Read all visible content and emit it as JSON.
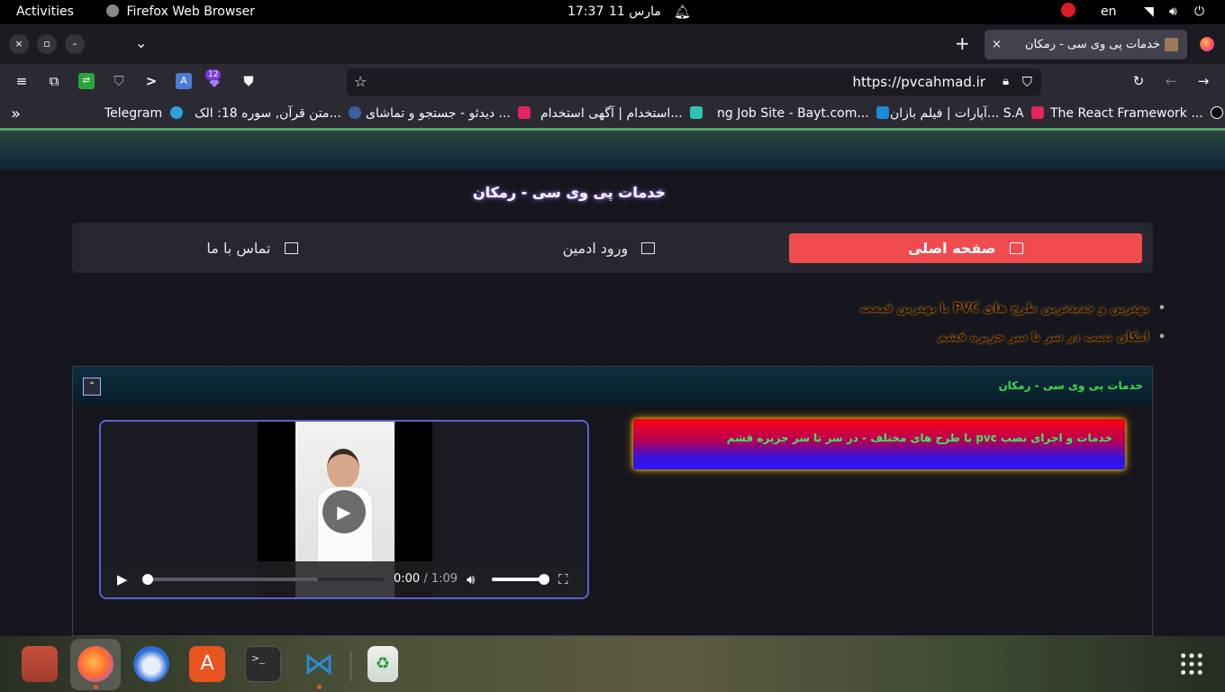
{
  "system_bar": {
    "activities": "Activities",
    "app_name": "Firefox Web Browser",
    "clock": "17:37",
    "date": "مارس 11",
    "language": "en"
  },
  "browser": {
    "tab": {
      "title": "خدمات پی وی سی - رمکان",
      "close": "×"
    },
    "new_tab": "+",
    "window_controls": {
      "close": "×",
      "restore": "▫",
      "minimize": "–"
    },
    "tab_list": "⌄",
    "url": "https://pvcahmad.ir",
    "extension_badge": "12",
    "bookmarks": [
      "The React Framework ...",
      "آپارات | فیلم بازان... S.A",
      "ng Job Site - Bayt.com...",
      "استخدام | آگهی استخدام...",
      "دیدئو - جستجو و تماشای ...",
      "متن قرآن, سوره 18: الک...",
      "Telegram"
    ],
    "bookmarks_overflow": "»"
  },
  "page": {
    "site_title": "خدمات پی وی سی - رمکان",
    "menu": [
      {
        "label": "صفحه اصلی",
        "icon": "home-icon",
        "active": true
      },
      {
        "label": "ورود ادمین",
        "icon": "book-icon",
        "active": false
      },
      {
        "label": "تماس با ما",
        "icon": "mail-icon",
        "active": false
      }
    ],
    "bullets": [
      "بهترین و جدیدترین طرح های PVC با بهترین قیمت",
      "امکان نصب در سر تا سر جزیره قشم"
    ],
    "panel": {
      "title": "خدمات پی وی سی - رمکان",
      "collapse_symbol": "⌃",
      "highlight_text": "خدمات و اجرای نصب pvc با طرح های مختلف - در سر تا سر جزیره قشم"
    },
    "video": {
      "current_time": "0:00",
      "duration": "/ 1:09",
      "progress": 0,
      "buffered": 0.72,
      "volume": 1
    }
  },
  "dock": {
    "apps": [
      "files-icon",
      "firefox-icon",
      "thunderbird-icon",
      "app-center-icon",
      "terminal-icon",
      "vscode-icon",
      "trash-icon"
    ]
  },
  "colors": {
    "accent_red": "#f04b4f",
    "panel_title_green": "#3ddc4a",
    "video_border": "#5c5fd0"
  }
}
